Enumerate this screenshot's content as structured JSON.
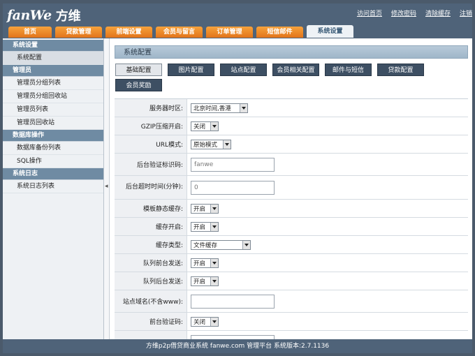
{
  "header": {
    "logo_en": "fanWe",
    "logo_zh": "方维",
    "links": [
      "访问首页",
      "修改密码",
      "清除缓存",
      "注销"
    ]
  },
  "nav": {
    "tabs": [
      "首页",
      "贷款管理",
      "前端设置",
      "会员与留言",
      "订单管理",
      "短信邮件",
      "系统设置"
    ],
    "active": "系统设置"
  },
  "sidebar": {
    "groups": [
      {
        "title": "系统设置",
        "items": [
          "系统配置"
        ]
      },
      {
        "title": "管理员",
        "items": [
          "管理员分组列表",
          "管理员分组回收站",
          "管理员列表",
          "管理员回收站"
        ]
      },
      {
        "title": "数据库操作",
        "items": [
          "数据库备份列表",
          "SQL操作"
        ]
      },
      {
        "title": "系统日志",
        "items": [
          "系统日志列表"
        ]
      }
    ],
    "active_item": "系统配置",
    "toggle_glyph": "◂"
  },
  "main": {
    "title": "系统配置",
    "tabs": [
      "基础配置",
      "图片配置",
      "站点配置",
      "会员相关配置",
      "邮件与短信",
      "贷款配置",
      "会员奖励"
    ],
    "active_tab": "基础配置"
  },
  "form": {
    "rows": [
      {
        "label": "服务器时区:",
        "type": "select",
        "value": "北京时间,香港"
      },
      {
        "label": "GZIP压缩开启:",
        "type": "select",
        "value": "关闭"
      },
      {
        "label": "URL模式:",
        "type": "select",
        "value": "原始模式"
      },
      {
        "label": "后台验证标识码:",
        "type": "input",
        "value": "fanwe"
      },
      {
        "label": "后台超时时间(分钟):",
        "type": "input",
        "value": "0"
      },
      {
        "label": "模板静态缓存:",
        "type": "select",
        "value": "开启"
      },
      {
        "label": "缓存开启:",
        "type": "select",
        "value": "开启"
      },
      {
        "label": "缓存类型:",
        "type": "select",
        "value": "文件缓存"
      },
      {
        "label": "队列前台发送:",
        "type": "select",
        "value": "开启"
      },
      {
        "label": "队列后台发送:",
        "type": "select",
        "value": "开启"
      },
      {
        "label": "站点域名(不含www):",
        "type": "input",
        "value": ""
      },
      {
        "label": "前台验证码:",
        "type": "select",
        "value": "关闭"
      },
      {
        "label": "",
        "type": "input",
        "value": ""
      }
    ]
  },
  "footer": {
    "text": "方维p2p借贷商业系统 fanwe.com 管理平台 系统版本:2.7.1136"
  },
  "colors": {
    "header_bg": "#4f6379",
    "tab_orange": "#f0932c",
    "sidebar_head": "#6f8ba3",
    "button_dark": "#3d4f63"
  }
}
